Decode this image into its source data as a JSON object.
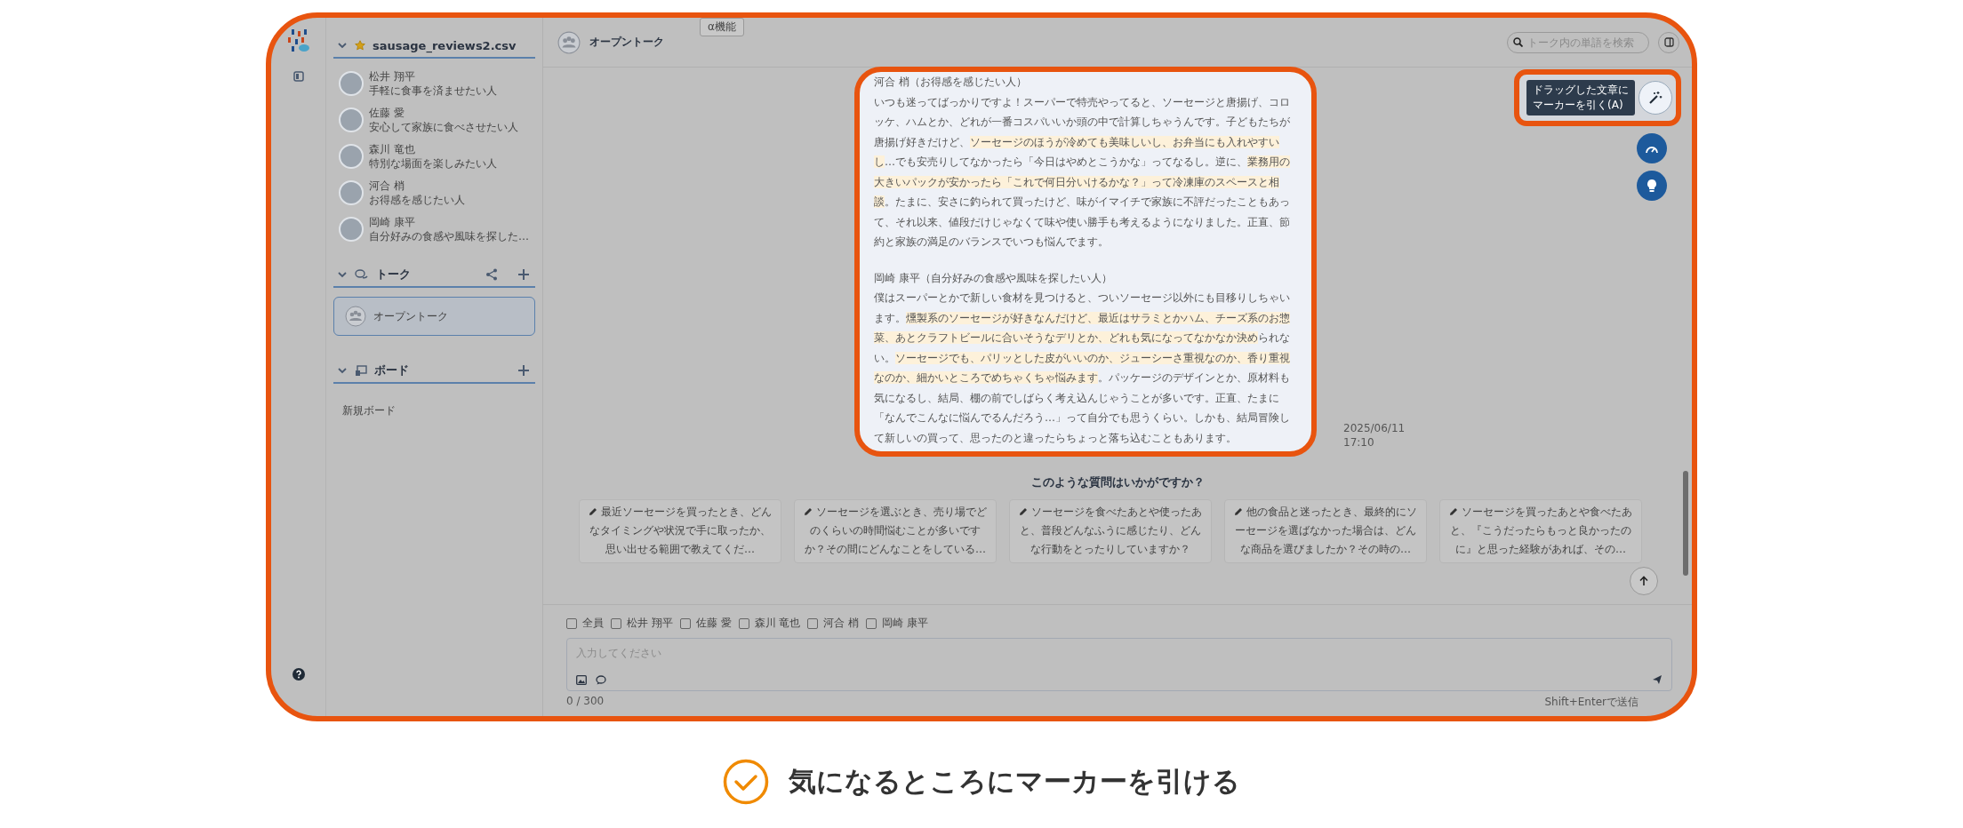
{
  "sidebar": {
    "file": {
      "name": "sausage_reviews2.csv",
      "starred": true,
      "expanded": true
    },
    "personas": [
      {
        "name": "松井 翔平",
        "description": "手軽に食事を済ませたい人"
      },
      {
        "name": "佐藤 愛",
        "description": "安心して家族に食べさせたい人"
      },
      {
        "name": "森川 竜也",
        "description": "特別な場面を楽しみたい人"
      },
      {
        "name": "河合 梢",
        "description": "お得感を感じたい人"
      },
      {
        "name": "岡崎 康平",
        "description": "自分好みの食感や風味を探した…"
      }
    ],
    "talk_section": {
      "title": "トーク",
      "expanded": true,
      "items": [
        {
          "label": "オープントーク",
          "selected": true
        }
      ]
    },
    "board_section": {
      "title": "ボード",
      "expanded": true,
      "items": [
        {
          "label": "新規ボード",
          "selected": false
        }
      ]
    }
  },
  "header": {
    "title": "オープントーク",
    "badge": "α機能",
    "search": {
      "placeholder": "トーク内の単語を検索"
    }
  },
  "messages": [
    {
      "speaker": "河合 梢（お得感を感じたい人）",
      "segments": [
        {
          "text": "いつも迷ってばっかりですよ！スーパーで特売やってると、ソーセージと唐揚げ、コロッケ、ハムとか、どれが一番コスパいいか頭の中で計算しちゃうんです。子どもたちが唐揚げ好きだけど、",
          "highlighted": false
        },
        {
          "text": "ソーセージのほうが冷めても美味しいし、お弁当にも入れやすいし",
          "highlighted": true
        },
        {
          "text": "…でも安売りしてなかったら「今日はやめとこうかな」ってなるし。逆に、",
          "highlighted": false
        },
        {
          "text": "業務用の大きいパックが安かったら「これで何日分いけるかな？」って冷凍庫のスペースと相談",
          "highlighted": true
        },
        {
          "text": "。たまに、安さに釣られて買ったけど、味がイマイチで家族に不評だったこともあって、それ以来、値段だけじゃなくて味や使い勝手も考えるようになりました。正直、節約と家族の満足のバランスでいつも悩んでます。",
          "highlighted": false
        }
      ]
    },
    {
      "speaker": "岡崎 康平（自分好みの食感や風味を探したい人）",
      "segments": [
        {
          "text": "僕はスーパーとかで新しい食材を見つけると、ついソーセージ以外にも目移りしちゃいます。",
          "highlighted": false
        },
        {
          "text": "燻製系のソーセージが好きなんだけど、最近はサラミとかハム、チーズ系のお惣菜、あとクラフトビールに合いそうなデリとか、どれも気になってなかなか決め",
          "highlighted": true
        },
        {
          "text": "られない。",
          "highlighted": false
        },
        {
          "text": "ソーセージでも、パリッとした皮がいいのか、ジューシーさ重視なのか、香り重視なのか、細かいところでめちゃくちゃ悩みます",
          "highlighted": true
        },
        {
          "text": "。パッケージのデザインとか、原材料も気になるし、結局、棚の前でしばらく考え込んじゃうことが多いです。正直、たまに「なんでこんなに悩んでるんだろう…」って自分でも思うくらい。しかも、結局冒険して新しいの買って、思ったのと違ったらちょっと落ち込むこともあります。",
          "highlighted": false
        }
      ]
    }
  ],
  "timestamp": {
    "date": "2025/06/11",
    "time": "17:10"
  },
  "tooltip": {
    "lines": [
      "ドラッグした文章に",
      "マーカーを引く(A)"
    ]
  },
  "suggestions": {
    "heading": "このような質問はいかがですか？",
    "items": [
      "最近ソーセージを買ったとき、どんなタイミングや状況で手に取ったか、思い出せる範囲で教えてくだ…",
      "ソーセージを選ぶとき、売り場でどのくらいの時間悩むことが多いですか？その間にどんなことをしている…",
      "ソーセージを食べたあとや使ったあと、普段どんなふうに感じたり、どんな行動をとったりしていますか？",
      "他の食品と迷ったとき、最終的にソーセージを選ばなかった場合は、どんな商品を選びましたか？その時の…",
      "ソーセージを買ったあとや食べたあと、『こうだったらもっと良かったのに』と思った経験があれば、その…"
    ]
  },
  "composer": {
    "recipients": [
      {
        "label": "全員",
        "checked": false
      },
      {
        "label": "松井 翔平",
        "checked": false
      },
      {
        "label": "佐藤 愛",
        "checked": false
      },
      {
        "label": "森川 竜也",
        "checked": false
      },
      {
        "label": "河合 梢",
        "checked": false
      },
      {
        "label": "岡崎 康平",
        "checked": false
      }
    ],
    "placeholder": "入力してください",
    "counter": "0 / 300",
    "hint": "Shift+Enterで送信"
  },
  "caption": "気になるところにマーカーを引ける"
}
